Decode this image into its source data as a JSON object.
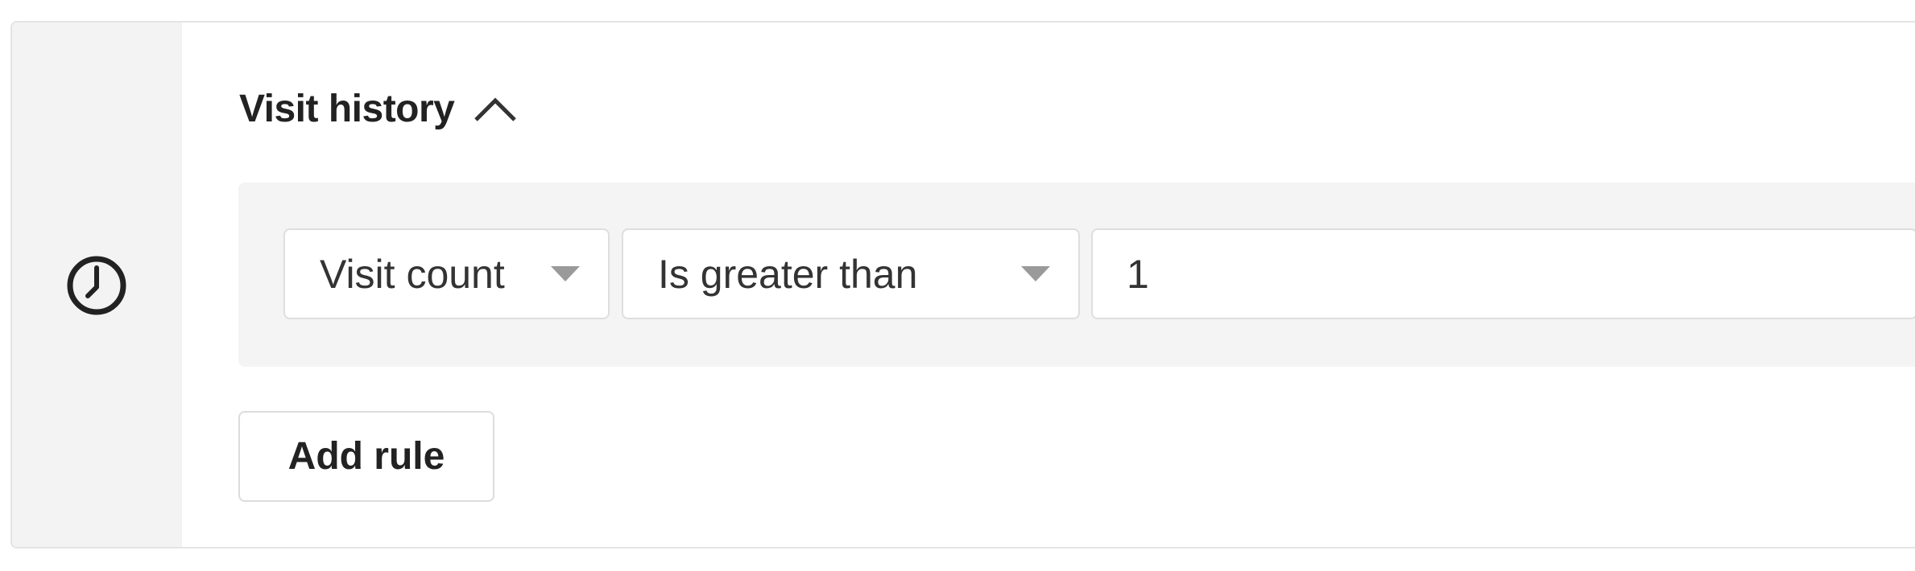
{
  "section": {
    "title": "Visit history",
    "expanded": true,
    "icon": "clock-icon",
    "toggle_icon": "chevron-up-icon"
  },
  "rule": {
    "field_select": {
      "value": "Visit count",
      "arrow_icon": "caret-down-icon"
    },
    "operator_select": {
      "value": "Is greater than",
      "arrow_icon": "caret-down-icon"
    },
    "value_input": {
      "value": "1"
    }
  },
  "actions": {
    "add_rule_label": "Add rule"
  },
  "colors": {
    "gutter": "#f3f3f3",
    "panel": "#f4f4f4",
    "border": "#dedede",
    "text": "#222222",
    "caret": "#9a9a9a"
  }
}
